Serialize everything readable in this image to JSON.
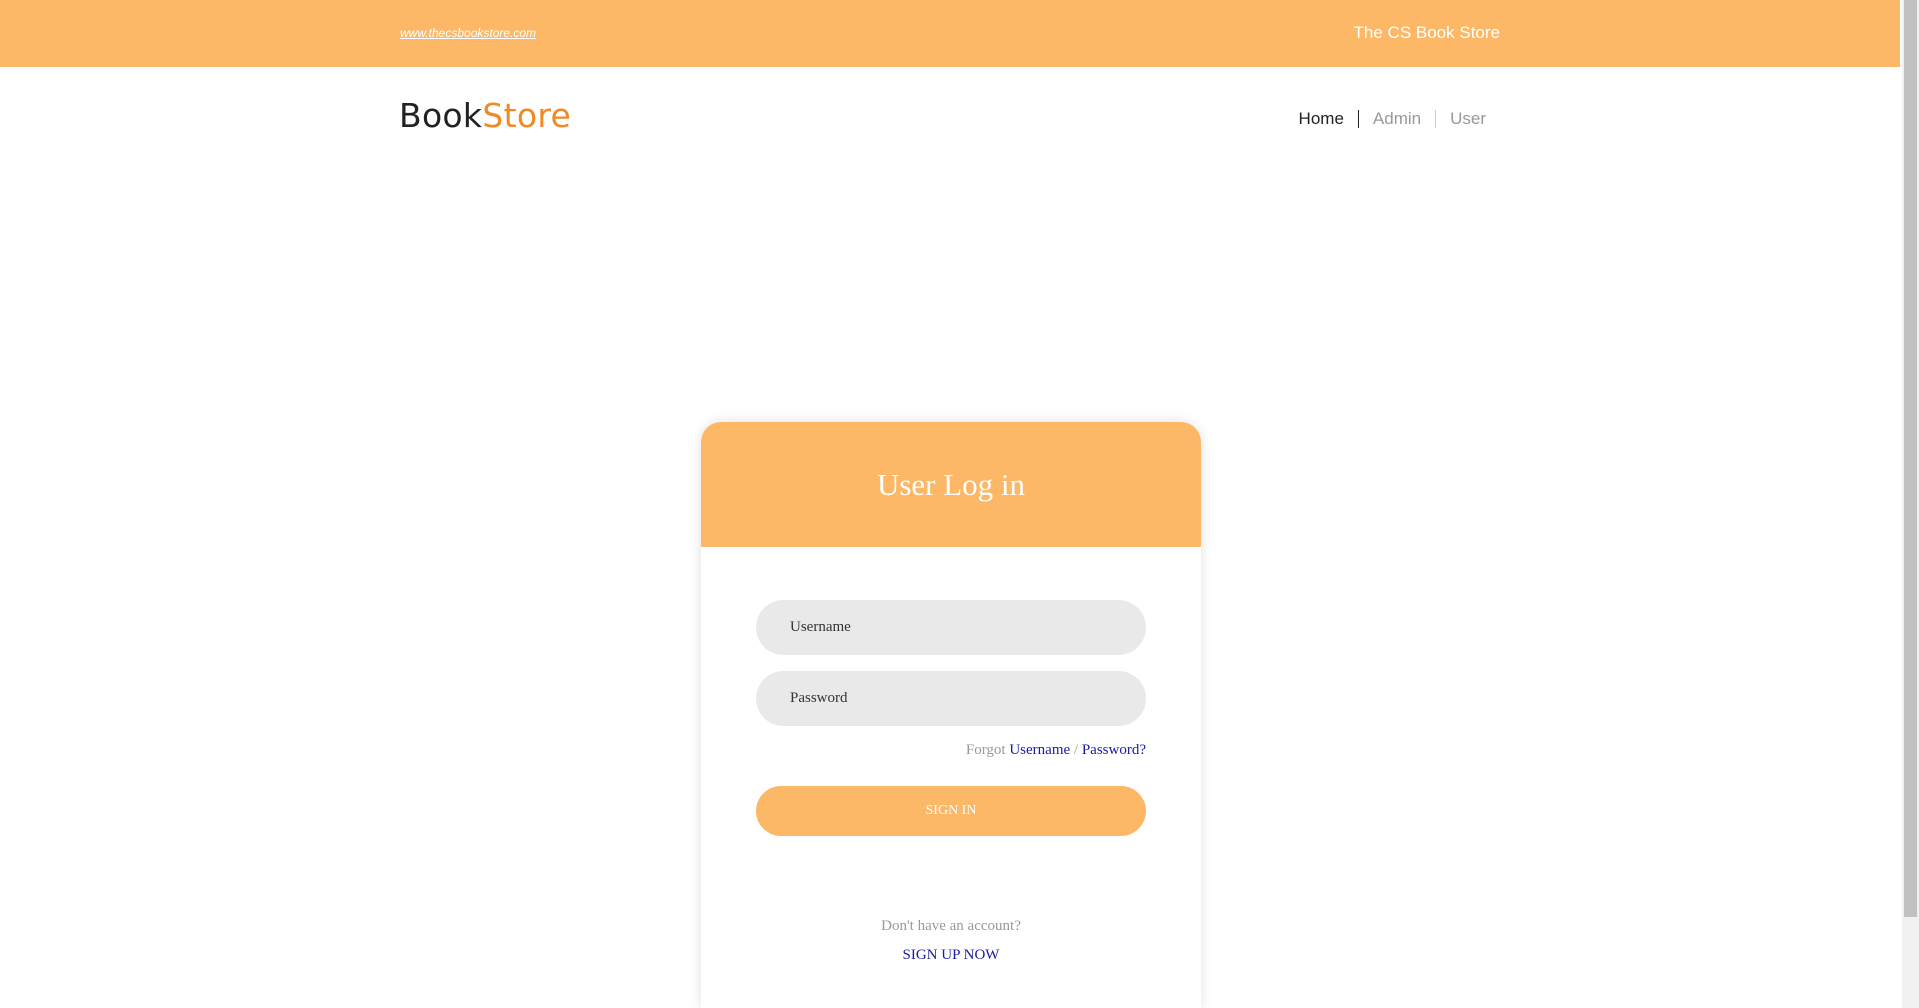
{
  "topbar": {
    "website_link": "www.thecsbookstore.com",
    "store_title": "The CS Book Store"
  },
  "brand": {
    "part1": "Book",
    "part2": "Store"
  },
  "nav": {
    "items": [
      "Home",
      "Admin",
      "User"
    ],
    "active": "Home"
  },
  "login_card": {
    "title": "User Log in",
    "username_placeholder": "Username",
    "password_placeholder": "Password",
    "forgot_prefix": "Forgot",
    "forgot_username": "Username",
    "forgot_separator": "/",
    "forgot_password": "Password?",
    "signin_label": "SIGN IN",
    "no_account_text": "Don't have an account?",
    "signup_label": "SIGN UP NOW"
  },
  "colors": {
    "accent": "#fcb866",
    "brand_orange": "#f08a24",
    "link_blue": "#1a1aa6"
  }
}
